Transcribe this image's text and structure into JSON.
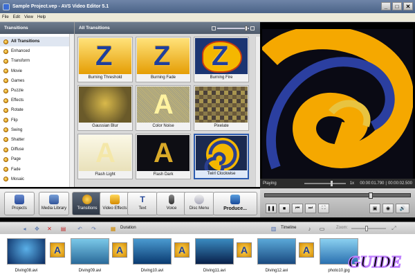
{
  "window": {
    "title": "Sample Project.vep - AVS Video Editor 5.1"
  },
  "menu": [
    "File",
    "Edit",
    "View",
    "Help"
  ],
  "left_panel": {
    "header": "Transitions",
    "items": [
      "All Transitions",
      "Enhanced",
      "Transform",
      "Movie",
      "Games",
      "Puzzle",
      "Effects",
      "Rotate",
      "Flip",
      "Swing",
      "Shatter",
      "Diffuse",
      "Page",
      "Fade",
      "Mosaic"
    ]
  },
  "center_panel": {
    "header": "All Transitions",
    "tiles": [
      "Burning Threshold",
      "Burning Fade",
      "Burning Fire",
      "Gaussian Blur",
      "Color Noise",
      "Pixelate",
      "Flash Light",
      "Flash Dark",
      "Twirl Clockwise"
    ],
    "selected": "Twirl Clockwise"
  },
  "player": {
    "status": "Playing",
    "speed": "1x",
    "time_current": "00:00:01.790",
    "time_total": "00:00:02.500"
  },
  "toolbar": {
    "projects": "Projects",
    "media_library": "Media Library",
    "transitions": "Transitions",
    "video_effects": "Video Effects",
    "text": "Text",
    "voice": "Voice",
    "disc_menu": "Disc Menu",
    "produce": "Produce..."
  },
  "timeline_bar": {
    "duration": "Duration",
    "timeline": "Timeline",
    "zoom": "Zoom:"
  },
  "clips": [
    "Diving08.avi",
    "Diving09.avi",
    "Diving10.avi",
    "Diving11.avi",
    "Diving12.avi",
    "photo10.jpg"
  ],
  "watermark": "GUIDE",
  "colors": {
    "accent": "#2b5bb0",
    "toolbar_active": "#3a4454",
    "transition_gold": "#f5b700",
    "transition_blue": "#1f3f9c"
  }
}
